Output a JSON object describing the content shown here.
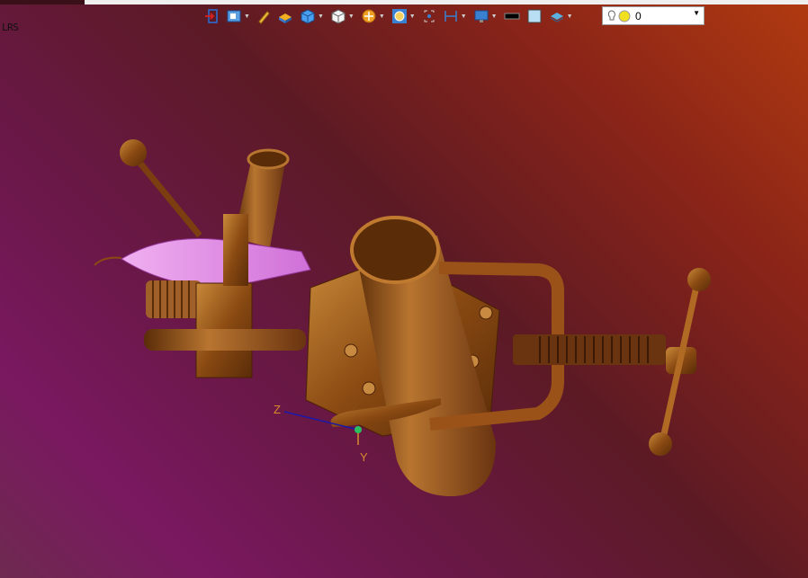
{
  "window": {
    "corner_text": "LRS"
  },
  "toolbar": {
    "items": [
      {
        "icon": "exit-icon"
      },
      {
        "icon": "display-mode-icon",
        "dropdown": true
      },
      {
        "icon": "pencil-icon"
      },
      {
        "icon": "surface-shade-icon"
      },
      {
        "icon": "cube-blue-icon",
        "dropdown": true
      },
      {
        "icon": "cube-white-icon",
        "dropdown": true
      },
      {
        "icon": "section-icon",
        "dropdown": true
      },
      {
        "icon": "zoom-icon",
        "dropdown": true
      },
      {
        "icon": "fit-view-icon"
      },
      {
        "icon": "measure-icon",
        "dropdown": true
      },
      {
        "icon": "screen-icon",
        "dropdown": true
      },
      {
        "icon": "black-rect-icon"
      },
      {
        "icon": "light-blue-square-icon"
      },
      {
        "icon": "layers-icon",
        "dropdown": true
      }
    ],
    "light_selector": {
      "value": "0",
      "icon": "lightbulb-icon"
    }
  },
  "viewport": {
    "axes": {
      "z": "Z",
      "y": "Y"
    },
    "colors": {
      "bronze": "#8a4a12",
      "bronze_light": "#c07a30",
      "flame": "#e79ae9"
    }
  }
}
